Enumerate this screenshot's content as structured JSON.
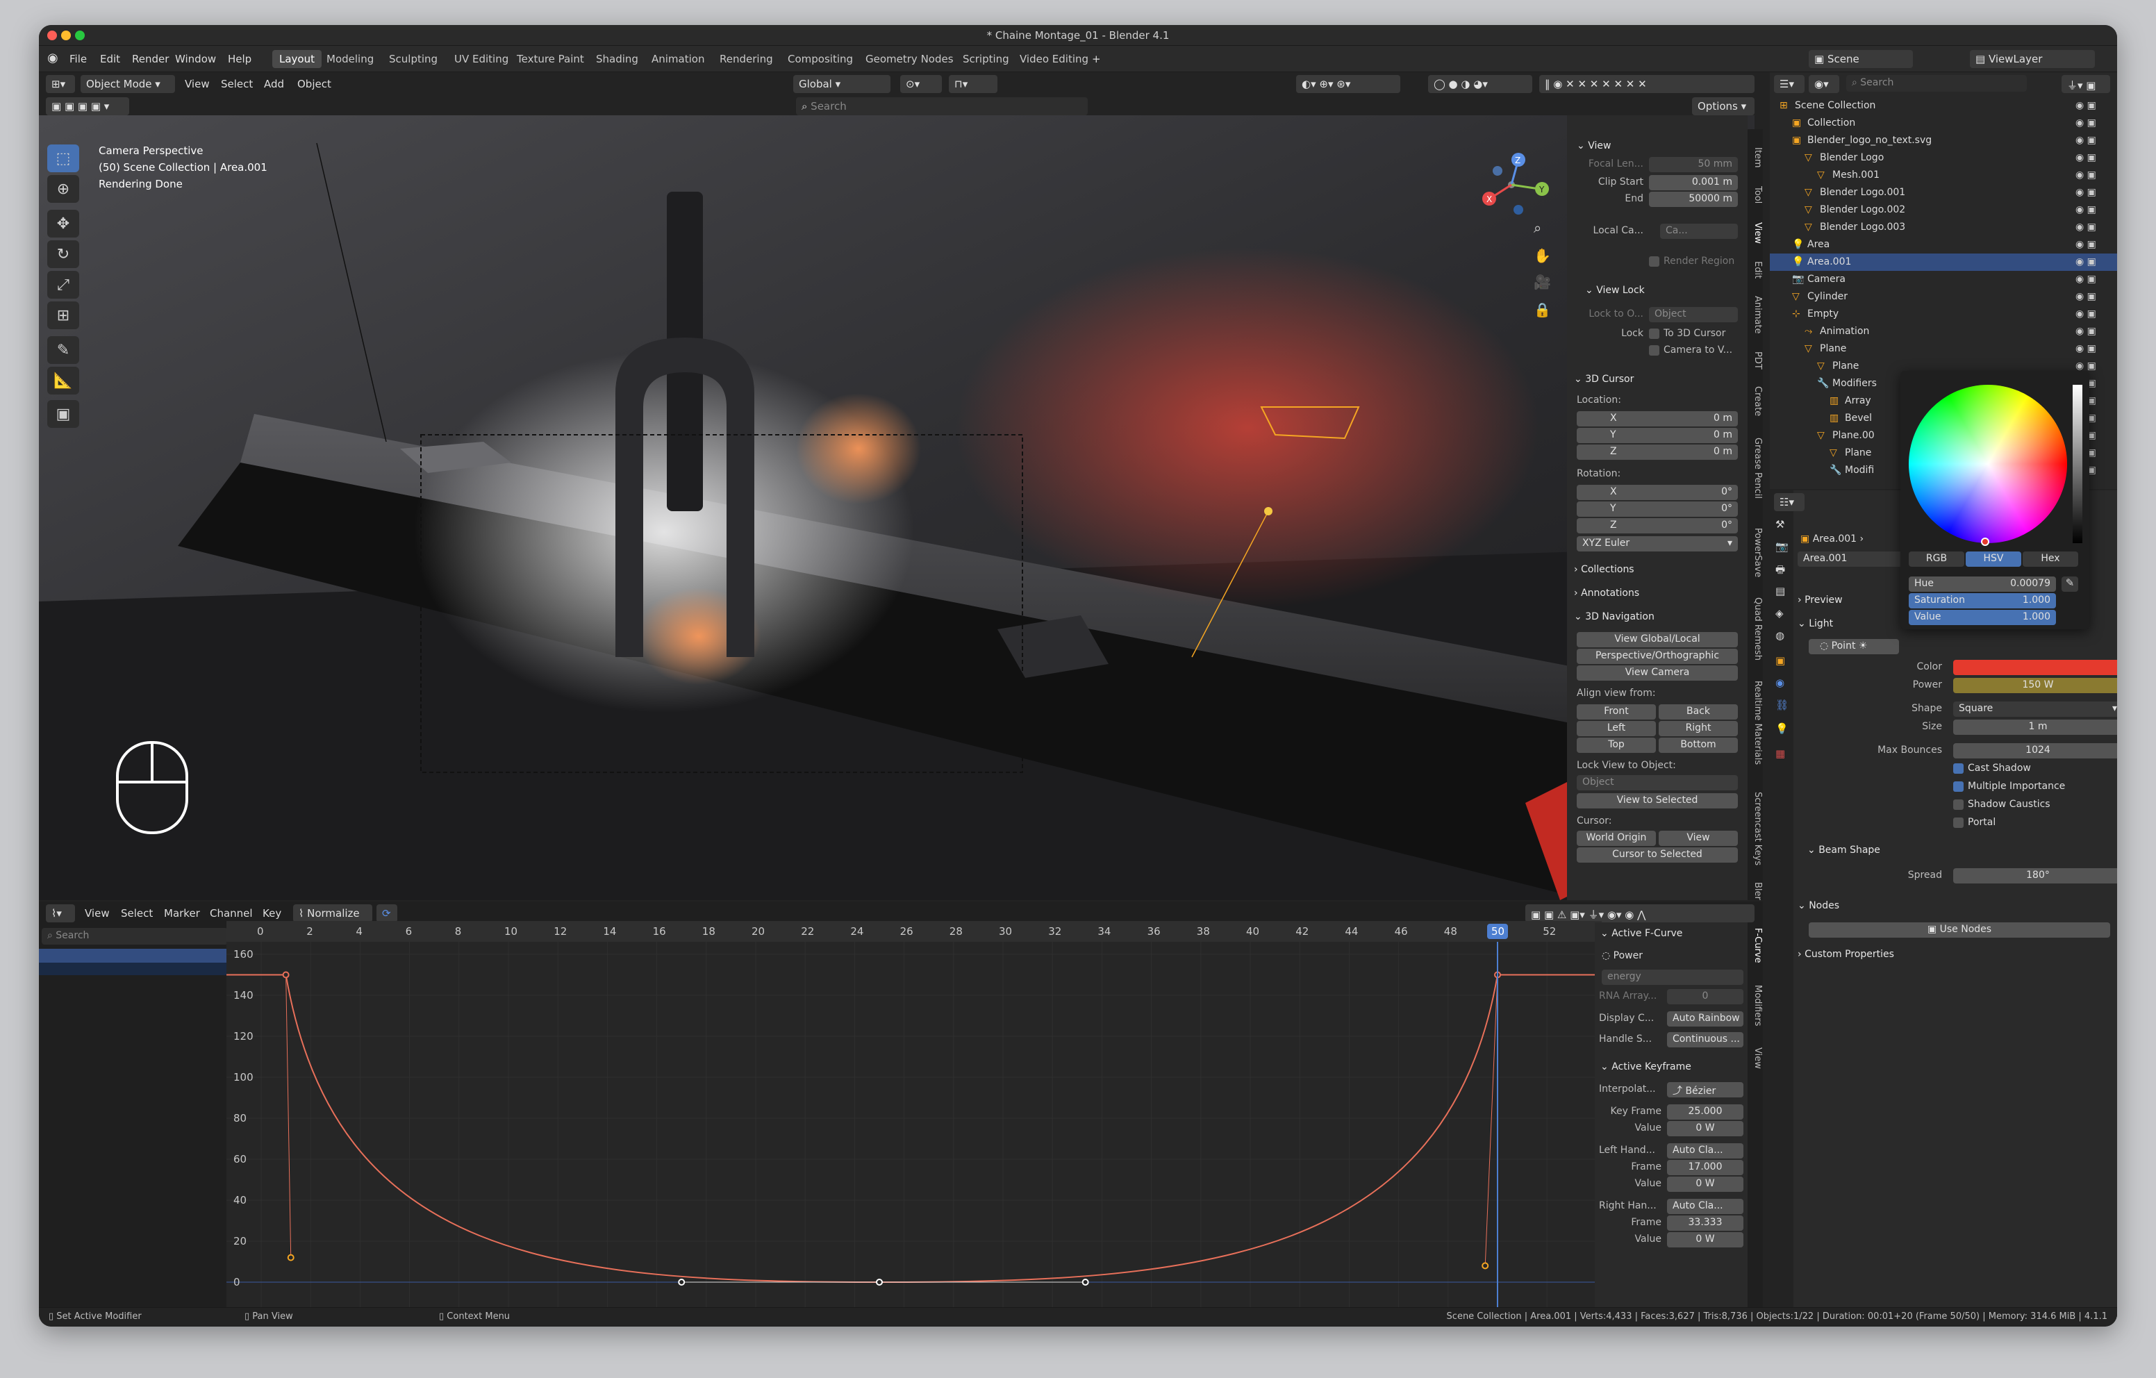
{
  "window": {
    "title": "* Chaine Montage_01 - Blender 4.1"
  },
  "menu": [
    "File",
    "Edit",
    "Render",
    "Window",
    "Help"
  ],
  "workspaces": [
    "Layout",
    "Modeling",
    "Sculpting",
    "UV Editing",
    "Texture Paint",
    "Shading",
    "Animation",
    "Rendering",
    "Compositing",
    "Geometry Nodes",
    "Scripting",
    "Video Editing"
  ],
  "active_workspace": "Layout",
  "scene": {
    "label": "Scene",
    "viewlayer": "ViewLayer"
  },
  "viewport_header": {
    "mode": "Object Mode",
    "menus": [
      "View",
      "Select",
      "Add",
      "Object"
    ],
    "orientation": "Global",
    "search_placeholder": "Search",
    "options": "Options"
  },
  "viewport_overlay": {
    "line1": "Camera Perspective",
    "line2": "(50) Scene Collection | Area.001",
    "line3": "Rendering Done"
  },
  "npanel": {
    "view_title": "View",
    "focal_label": "Focal Len...",
    "focal_value": "50 mm",
    "clip_start_label": "Clip Start",
    "clip_start_value": "0.001 m",
    "clip_end_label": "End",
    "clip_end_value": "50000 m",
    "local_cam_label": "Local Ca...",
    "local_cam_value": "Ca...",
    "render_region": "Render Region",
    "view_lock": "View Lock",
    "lock_to_label": "Lock to O...",
    "lock_to_value": "Object",
    "lock_label": "Lock",
    "to_3d_cursor": "To 3D Cursor",
    "camera_to_view": "Camera to V...",
    "cursor_title": "3D Cursor",
    "location": "Location:",
    "rotation": "Rotation:",
    "loc": [
      {
        "axis": "X",
        "value": "0 m"
      },
      {
        "axis": "Y",
        "value": "0 m"
      },
      {
        "axis": "Z",
        "value": "0 m"
      }
    ],
    "rot": [
      {
        "axis": "X",
        "value": "0°"
      },
      {
        "axis": "Y",
        "value": "0°"
      },
      {
        "axis": "Z",
        "value": "0°"
      }
    ],
    "euler": "XYZ Euler",
    "collections": "Collections",
    "annotations": "Annotations",
    "nav_title": "3D Navigation",
    "view_global_local": "View Global/Local",
    "persp_ortho": "Perspective/Orthographic",
    "view_camera": "View Camera",
    "align_from": "Align view from:",
    "align": [
      "Front",
      "Back",
      "Left",
      "Right",
      "Top",
      "Bottom"
    ],
    "lock_view": "Lock View to Object:",
    "object_placeholder": "Object",
    "view_selected": "View to Selected",
    "cursor": "Cursor:",
    "world_origin": "World Origin",
    "view": "View",
    "cursor_selected": "Cursor to Selected",
    "tabs": [
      "Item",
      "Tool",
      "View",
      "Edit",
      "Animate",
      "PDT",
      "Create",
      "Grease Pencil",
      "PowerSave",
      "Quad Remesh",
      "Realtime Materials",
      "Screencast Keys",
      "Bler"
    ]
  },
  "graph_editor": {
    "menus": [
      "View",
      "Select",
      "Marker",
      "Channel",
      "Key"
    ],
    "normalize": "Normalize",
    "search_placeholder": "Search",
    "frame_ticks": [
      "0",
      "2",
      "4",
      "6",
      "8",
      "10",
      "12",
      "14",
      "16",
      "18",
      "20",
      "22",
      "24",
      "26",
      "28",
      "30",
      "32",
      "34",
      "36",
      "38",
      "40",
      "42",
      "44",
      "46",
      "48",
      "50",
      "52"
    ],
    "y_ticks": [
      "160",
      "140",
      "120",
      "100",
      "80",
      "60",
      "40",
      "20",
      "0"
    ],
    "current_frame": "50",
    "curve_color": "#e8705a"
  },
  "fcurve_panel": {
    "active_fcurve": "Active F-Curve",
    "channel": "Power",
    "data_path": "energy",
    "rna_label": "RNA Array...",
    "rna_value": "0",
    "display_label": "Display C...",
    "display_value": "Auto Rainbow",
    "handle_label": "Handle S...",
    "handle_value": "Continuous ...",
    "active_keyframe": "Active Keyframe",
    "interp_label": "Interpolat...",
    "interp_value": "Bézier",
    "key_frame_label": "Key Frame",
    "key_frame_value": "25.000",
    "value_label": "Value",
    "key_value": "0 W",
    "left_handle_label": "Left Hand...",
    "left_handle_type": "Auto Cla...",
    "frame_label": "Frame",
    "left_frame": "17.000",
    "left_value": "0 W",
    "right_handle_label": "Right Han...",
    "right_handle_type": "Auto Cla...",
    "right_frame": "33.333",
    "right_value": "0 W",
    "tabs": [
      "F-Curve",
      "Modifiers",
      "View"
    ]
  },
  "outliner": {
    "search_placeholder": "Search",
    "rows": [
      {
        "label": "Scene Collection",
        "indent": 0
      },
      {
        "label": "Collection",
        "indent": 1
      },
      {
        "label": "Blender_logo_no_text.svg",
        "indent": 1
      },
      {
        "label": "Blender Logo",
        "indent": 2
      },
      {
        "label": "Mesh.001",
        "indent": 3
      },
      {
        "label": "Blender Logo.001",
        "indent": 2
      },
      {
        "label": "Blender Logo.002",
        "indent": 2
      },
      {
        "label": "Blender Logo.003",
        "indent": 2
      },
      {
        "label": "Area",
        "indent": 1
      },
      {
        "label": "Area.001",
        "indent": 1
      },
      {
        "label": "Camera",
        "indent": 1
      },
      {
        "label": "Cylinder",
        "indent": 1
      },
      {
        "label": "Empty",
        "indent": 1
      },
      {
        "label": "Animation",
        "indent": 2
      },
      {
        "label": "Plane",
        "indent": 2
      },
      {
        "label": "Plane",
        "indent": 3
      },
      {
        "label": "Modifiers",
        "indent": 3
      },
      {
        "label": "Array",
        "indent": 4
      },
      {
        "label": "Bevel",
        "indent": 4
      },
      {
        "label": "Plane.00",
        "indent": 3
      },
      {
        "label": "Plane",
        "indent": 4
      },
      {
        "label": "Modifi",
        "indent": 4
      }
    ]
  },
  "color_picker": {
    "tabs": [
      "RGB",
      "HSV",
      "Hex"
    ],
    "active": "HSV",
    "hue_label": "Hue",
    "hue_value": "0.00079",
    "sat_label": "Saturation",
    "sat_value": "1.000",
    "val_label": "Value",
    "val_value": "1.000"
  },
  "properties": {
    "object_name": "Area.001",
    "data_name": "Area.001",
    "preview": "Preview",
    "light": "Light",
    "point": "Point",
    "color_label": "Color",
    "color_value": "#e53a2d",
    "power_label": "Power",
    "power_value": "150 W",
    "shape_label": "Shape",
    "shape_value": "Square",
    "size_label": "Size",
    "size_value": "1 m",
    "bounces_label": "Max Bounces",
    "bounces_value": "1024",
    "cast_shadow": "Cast Shadow",
    "multiple_importance": "Multiple Importance",
    "shadow_caustics": "Shadow Caustics",
    "portal": "Portal",
    "beam_shape": "Beam Shape",
    "spread_label": "Spread",
    "spread_value": "180°",
    "nodes": "Nodes",
    "use_nodes": "Use Nodes",
    "custom_props": "Custom Properties"
  },
  "statusbar": {
    "left1": "Set Active Modifier",
    "left2": "Pan View",
    "left3": "Context Menu",
    "right": "Scene Collection | Area.001 | Verts:4,433 | Faces:3,627 | Tris:8,736 | Objects:1/22 | Duration: 00:01+20 (Frame 50/50) | Memory: 314.6 MiB | 4.1.1"
  }
}
